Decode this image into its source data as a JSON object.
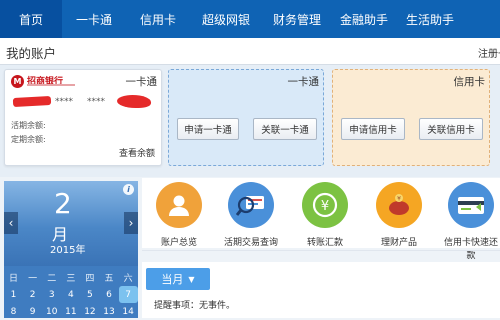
{
  "nav": {
    "items": [
      {
        "label": "首页"
      },
      {
        "label": "一卡通"
      },
      {
        "label": "信用卡"
      },
      {
        "label": "超级网银"
      },
      {
        "label": "财务管理"
      },
      {
        "label": "金融助手"
      },
      {
        "label": "生活助手"
      }
    ]
  },
  "header": {
    "title": "我的账户",
    "link": "注册一"
  },
  "bank_card": {
    "bank_name": "招商银行",
    "type": "一卡通",
    "masked1": "****",
    "masked2": "****",
    "current_balance_label": "活期余额:",
    "fixed_balance_label": "定期余额:",
    "view_balance": "查看余额"
  },
  "card2": {
    "title": "一卡通",
    "btn1": "申请一卡通",
    "btn2": "关联一卡通"
  },
  "card3": {
    "title": "信用卡",
    "btn1": "申请信用卡",
    "btn2": "关联信用卡"
  },
  "calendar": {
    "day": "2",
    "month": "月",
    "year": "2015年",
    "weekdays": [
      "日",
      "一",
      "二",
      "三",
      "四",
      "五",
      "六"
    ],
    "weeks": [
      [
        "1",
        "2",
        "3",
        "4",
        "5",
        "6",
        "7"
      ],
      [
        "8",
        "9",
        "10",
        "11",
        "12",
        "13",
        "14"
      ]
    ],
    "today": "7"
  },
  "shortcuts": [
    {
      "label": "账户总览",
      "icon": "person-icon",
      "color": "#f0a23a"
    },
    {
      "label": "活期交易查询",
      "icon": "magnifier-card-icon",
      "color": "#4a90d9"
    },
    {
      "label": "转账汇款",
      "icon": "yen-transfer-icon",
      "color": "#7cc242"
    },
    {
      "label": "理财产品",
      "icon": "piggy-bank-icon",
      "color": "#f5a623"
    },
    {
      "label": "信用卡快速还",
      "label2": "款",
      "icon": "credit-card-icon",
      "color": "#4a90d9"
    }
  ],
  "schedule": {
    "month_button": "当月",
    "reminder": "提醒事项：无事件。"
  }
}
